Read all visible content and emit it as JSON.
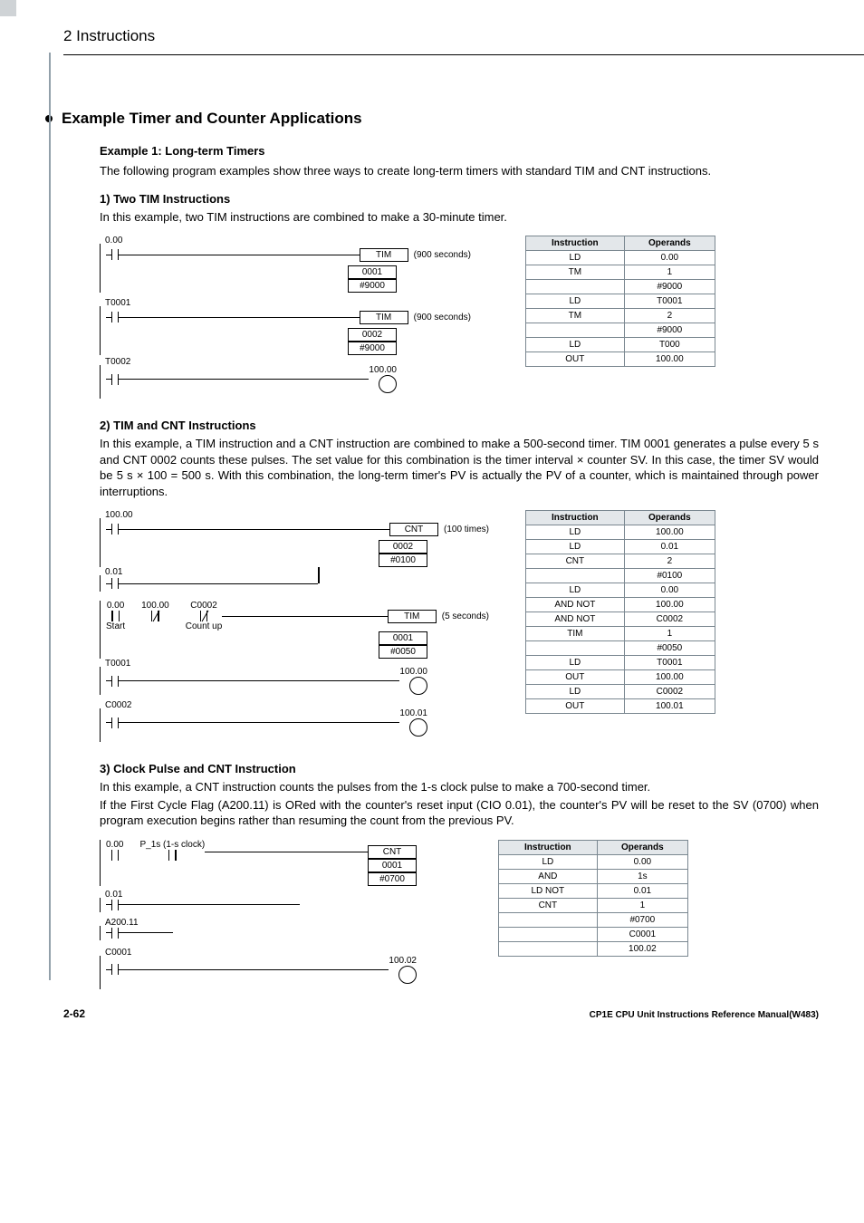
{
  "running_head": "2   Instructions",
  "section_heading": "Example Timer and Counter Applications",
  "example1_title": "Example 1: Long-term Timers",
  "example1_intro": "The following program examples show three ways to create long-term timers with standard TIM and CNT instructions.",
  "sub1_title": "1) Two TIM Instructions",
  "sub1_text": "In this example, two TIM instructions are combined to make a 30-minute timer.",
  "sub2_title": "2) TIM and CNT Instructions",
  "sub2_text": "In this example, a TIM instruction and a CNT instruction are combined to make a 500-second timer. TIM 0001 generates a pulse every 5 s and CNT 0002 counts these pulses. The set value for this combination is the timer interval × counter SV. In this case, the timer SV would be 5 s × 100 = 500 s. With this combination, the long-term timer's PV is actually the PV of a counter, which is maintained through power interruptions.",
  "sub3_title": "3) Clock Pulse and CNT Instruction",
  "sub3_text1": "In this example, a CNT instruction counts the pulses from the 1-s clock pulse to make a 700-second timer.",
  "sub3_text2": "If the First Cycle Flag (A200.11) is ORed with the counter's reset input (CIO 0.01), the counter's PV will be reset to the SV (0700) when program execution begins rather than resuming the count from the previous PV.",
  "diag1": {
    "c1": "0.00",
    "c2": "T0001",
    "c3": "T0002",
    "b1": "TIM",
    "b2": "0001",
    "b3": "#9000",
    "b4": "TIM",
    "b5": "0002",
    "b6": "#9000",
    "n1": "(900 seconds)",
    "n2": "(900 seconds)",
    "coil": "100.00",
    "table_head_i": "Instruction",
    "table_head_o": "Operands",
    "rows": [
      {
        "i": "LD",
        "o": "0.00"
      },
      {
        "i": "TM",
        "o": "1"
      },
      {
        "i": "",
        "o": "#9000"
      },
      {
        "i": "LD",
        "o": "T0001"
      },
      {
        "i": "TM",
        "o": "2"
      },
      {
        "i": "",
        "o": "#9000"
      },
      {
        "i": "LD",
        "o": "T000"
      },
      {
        "i": "OUT",
        "o": "100.00"
      }
    ]
  },
  "diag2": {
    "c1": "100.00",
    "c2": "0.01",
    "c3a": "0.00",
    "c3b": "100.00",
    "c3c": "C0002",
    "c3a_sub": "Start",
    "c3c_sub": "Count up",
    "c4": "T0001",
    "c5": "C0002",
    "b1": "CNT",
    "b2": "0002",
    "b3": "#0100",
    "n1": "(100 times)",
    "b4": "TIM",
    "b5": "0001",
    "b6": "#0050",
    "n2": "(5 seconds)",
    "coil1": "100.00",
    "coil2": "100.01",
    "table_head_i": "Instruction",
    "table_head_o": "Operands",
    "rows": [
      {
        "i": "LD",
        "o": "100.00"
      },
      {
        "i": "LD",
        "o": "0.01"
      },
      {
        "i": "CNT",
        "o": "2"
      },
      {
        "i": "",
        "o": "#0100"
      },
      {
        "i": "LD",
        "o": "0.00"
      },
      {
        "i": "AND NOT",
        "o": "100.00"
      },
      {
        "i": "AND NOT",
        "o": "C0002"
      },
      {
        "i": "TIM",
        "o": "1"
      },
      {
        "i": "",
        "o": "#0050"
      },
      {
        "i": "LD",
        "o": "T0001"
      },
      {
        "i": "OUT",
        "o": "100.00"
      },
      {
        "i": "LD",
        "o": "C0002"
      },
      {
        "i": "OUT",
        "o": "100.01"
      }
    ]
  },
  "diag3": {
    "c1": "0.00",
    "c1b": "P_1s (1-s clock)",
    "c2": "0.01",
    "c3": "A200.11",
    "c4": "C0001",
    "b1": "CNT",
    "b2": "0001",
    "b3": "#0700",
    "coil": "100.02",
    "table_head_i": "Instruction",
    "table_head_o": "Operands",
    "rows": [
      {
        "i": "LD",
        "o": "0.00"
      },
      {
        "i": "AND",
        "o": "1s"
      },
      {
        "i": "LD NOT",
        "o": "0.01"
      },
      {
        "i": "CNT",
        "o": "1"
      },
      {
        "i": "",
        "o": "#0700"
      },
      {
        "i": "",
        "o": "C0001"
      },
      {
        "i": "",
        "o": "100.02"
      }
    ]
  },
  "footer_page": "2-62",
  "footer_doc": "CP1E CPU Unit Instructions Reference Manual(W483)"
}
